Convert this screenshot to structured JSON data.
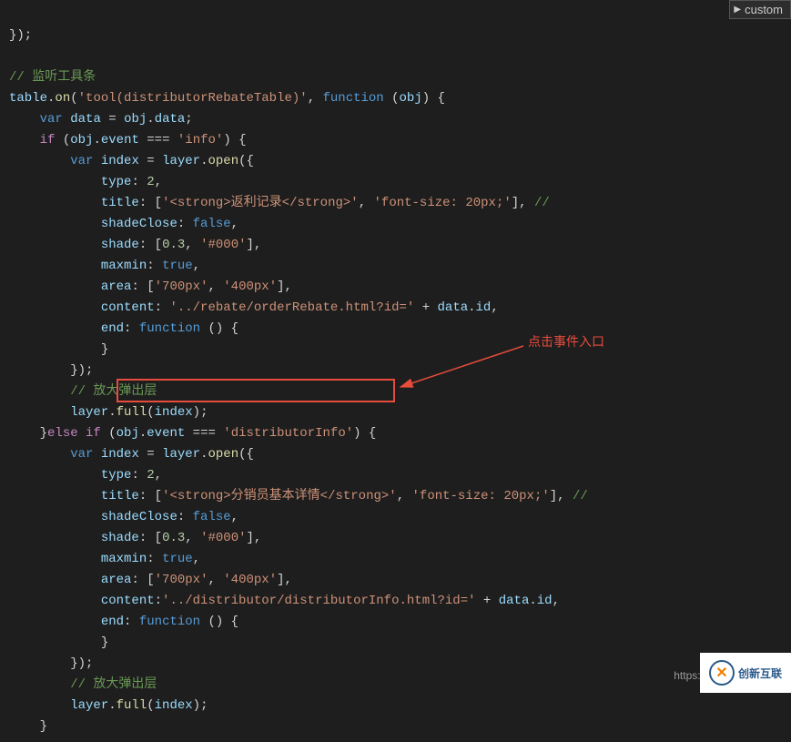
{
  "code": {
    "line0": "});",
    "blank1": "",
    "comment1": "// 监听工具条",
    "l1_table": "table",
    "l1_on": "on",
    "l1_str": "'tool(distributorRebateTable)'",
    "l1_func": "function",
    "l1_obj": "obj",
    "l2_var": "var",
    "l2_data": "data",
    "l2_obj": "obj",
    "l2_data2": "data",
    "l3_if": "if",
    "l3_obj": "obj",
    "l3_event": "event",
    "l3_info": "'info'",
    "l4_var": "var",
    "l4_index": "index",
    "l4_layer": "layer",
    "l4_open": "open",
    "l5_type": "type",
    "l5_val": "2",
    "l6_title": "title",
    "l6_str1": "'<strong>返利记录</strong>'",
    "l6_str2": "'font-size: 20px;'",
    "l6_cmt": "//",
    "l7_shadeClose": "shadeClose",
    "l7_false": "false",
    "l8_shade": "shade",
    "l8_v1": "0.3",
    "l8_v2": "'#000'",
    "l9_maxmin": "maxmin",
    "l9_true": "true",
    "l10_area": "area",
    "l10_v1": "'700px'",
    "l10_v2": "'400px'",
    "l11_content": "content",
    "l11_str": "'../rebate/orderRebate.html?id='",
    "l11_data": "data",
    "l11_id": "id",
    "l12_end": "end",
    "l12_func": "function",
    "l13_close": "}",
    "l14_close": "});",
    "l15_cmt": "// 放大弹出层",
    "l16_layer": "layer",
    "l16_full": "full",
    "l16_index": "index",
    "l17_else": "else if",
    "l17_obj": "obj",
    "l17_event": "event",
    "l17_str": "'distributorInfo'",
    "l18_var": "var",
    "l18_index": "index",
    "l18_layer": "layer",
    "l18_open": "open",
    "l19_type": "type",
    "l19_val": "2",
    "l20_title": "title",
    "l20_s1": "'<strong>分销员基本详情</strong>'",
    "l20_s2": "'font-size: 20px;'",
    "l20_cmt": "//",
    "l21_shadeClose": "shadeClose",
    "l21_false": "false",
    "l22_shade": "shade",
    "l22_v1": "0.3",
    "l22_v2": "'#000'",
    "l23_maxmin": "maxmin",
    "l23_true": "true",
    "l24_area": "area",
    "l24_v1": "'700px'",
    "l24_v2": "'400px'",
    "l25_content": "content",
    "l25_str": "'../distributor/distributorInfo.html?id='",
    "l25_data": "data",
    "l25_id": "id",
    "l26_end": "end",
    "l26_func": "function",
    "l27_close": "}",
    "l28_close": "});",
    "l29_cmt": "// 放大弹出层",
    "l30_layer": "layer",
    "l30_full": "full",
    "l30_index": "index",
    "l31_close": "}"
  },
  "annotation": {
    "text": "点击事件入口"
  },
  "sidebar": {
    "label": "custom"
  },
  "watermark": {
    "text": "https://blog.csdn.net/S"
  },
  "logo": {
    "icon": "✕",
    "text": "创新互联"
  }
}
